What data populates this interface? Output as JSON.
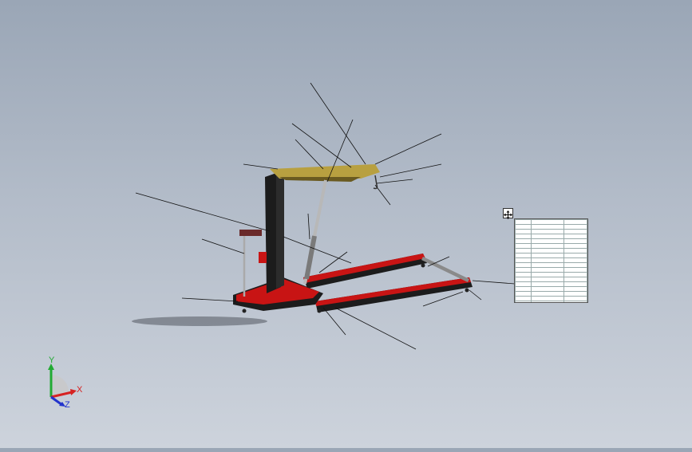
{
  "triad": {
    "y_label": "Y",
    "x_label": "X",
    "z_label": "Z",
    "colors": {
      "y": "#22aa33",
      "x": "#d62222",
      "z": "#2233cc"
    }
  },
  "model": {
    "colors": {
      "frame_red": "#c81414",
      "frame_black": "#1c1c1c",
      "boom_yellow": "#b8a040",
      "cylinder": "#b8b8b8",
      "leader_line": "#111111"
    }
  },
  "bom": {
    "icon": "move-table-icon",
    "row_count": 22
  }
}
